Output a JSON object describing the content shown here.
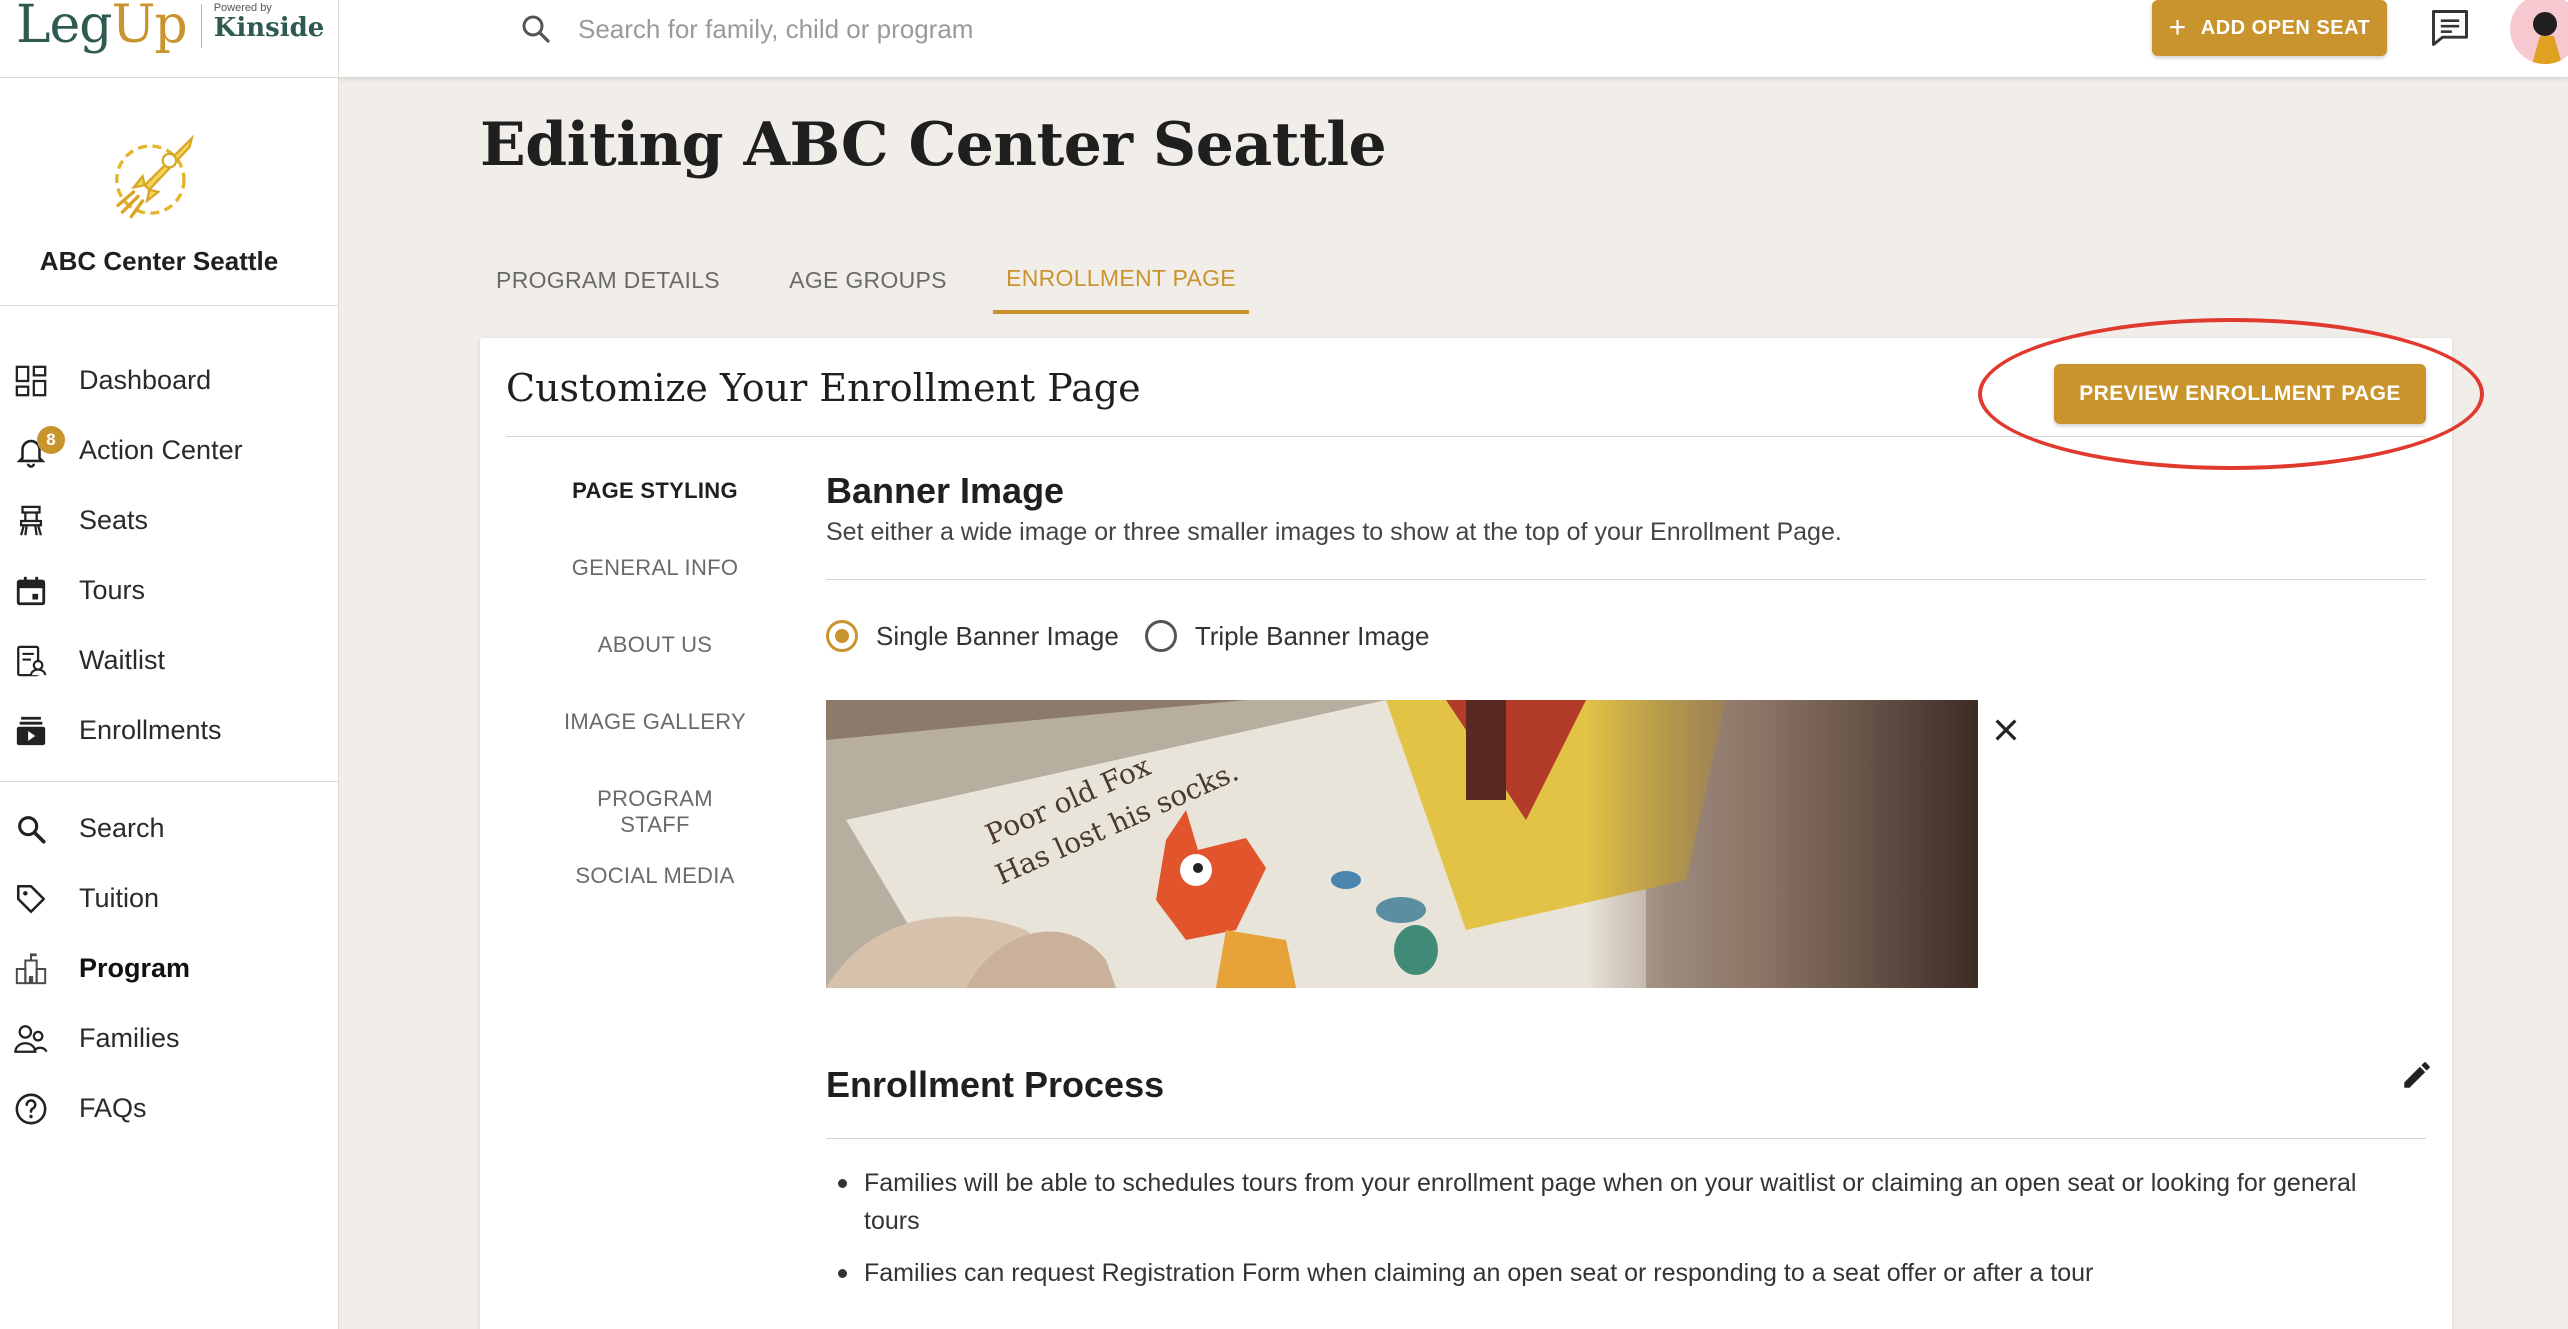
{
  "header": {
    "logo_main": "Leg",
    "logo_up": "Up",
    "logo_powered_by": "Powered by",
    "logo_partner": "Kinside",
    "search_placeholder": "Search for family, child or program",
    "add_seat_label": "ADD OPEN SEAT"
  },
  "sidebar": {
    "org_name": "ABC Center Seattle",
    "items": [
      {
        "label": "Dashboard",
        "icon": "dashboard-icon"
      },
      {
        "label": "Action Center",
        "icon": "bell-icon",
        "badge": "8"
      },
      {
        "label": "Seats",
        "icon": "seat-icon"
      },
      {
        "label": "Tours",
        "icon": "calendar-icon"
      },
      {
        "label": "Waitlist",
        "icon": "waitlist-icon"
      },
      {
        "label": "Enrollments",
        "icon": "enrollments-icon"
      },
      {
        "label": "Search",
        "icon": "search-icon"
      },
      {
        "label": "Tuition",
        "icon": "tag-icon"
      },
      {
        "label": "Program",
        "icon": "building-icon",
        "active": true
      },
      {
        "label": "Families",
        "icon": "families-icon"
      },
      {
        "label": "FAQs",
        "icon": "help-icon"
      }
    ]
  },
  "main": {
    "title": "Editing ABC Center Seattle",
    "tabs": [
      {
        "label": "PROGRAM DETAILS"
      },
      {
        "label": "AGE GROUPS"
      },
      {
        "label": "ENROLLMENT PAGE",
        "active": true
      }
    ],
    "card": {
      "title": "Customize Your Enrollment Page",
      "preview_label": "PREVIEW ENROLLMENT PAGE",
      "subnav": [
        {
          "label": "PAGE STYLING",
          "active": true
        },
        {
          "label": "GENERAL INFO"
        },
        {
          "label": "ABOUT US"
        },
        {
          "label": "IMAGE GALLERY"
        },
        {
          "label": "PROGRAM STAFF"
        },
        {
          "label": "SOCIAL MEDIA"
        }
      ],
      "banner": {
        "title": "Banner Image",
        "description": "Set either a wide image or three smaller images to show at the top of your Enrollment Page.",
        "option_single": "Single Banner Image",
        "option_triple": "Triple Banner Image",
        "selected": "Single Banner Image",
        "image_text_line1": "Poor old Fox",
        "image_text_line2": "Has lost his socks."
      },
      "process": {
        "title": "Enrollment Process",
        "bullets": [
          "Families will be able to schedules tours from your enrollment page when on your waitlist or claiming an open seat or looking for general tours",
          "Families can request Registration Form when claiming an open seat or responding to a seat offer or after a tour"
        ]
      }
    }
  },
  "colors": {
    "accent": "#c9932d",
    "brand_green": "#2f5a52",
    "background": "#f1eeea",
    "annotation": "#e03a2f"
  }
}
